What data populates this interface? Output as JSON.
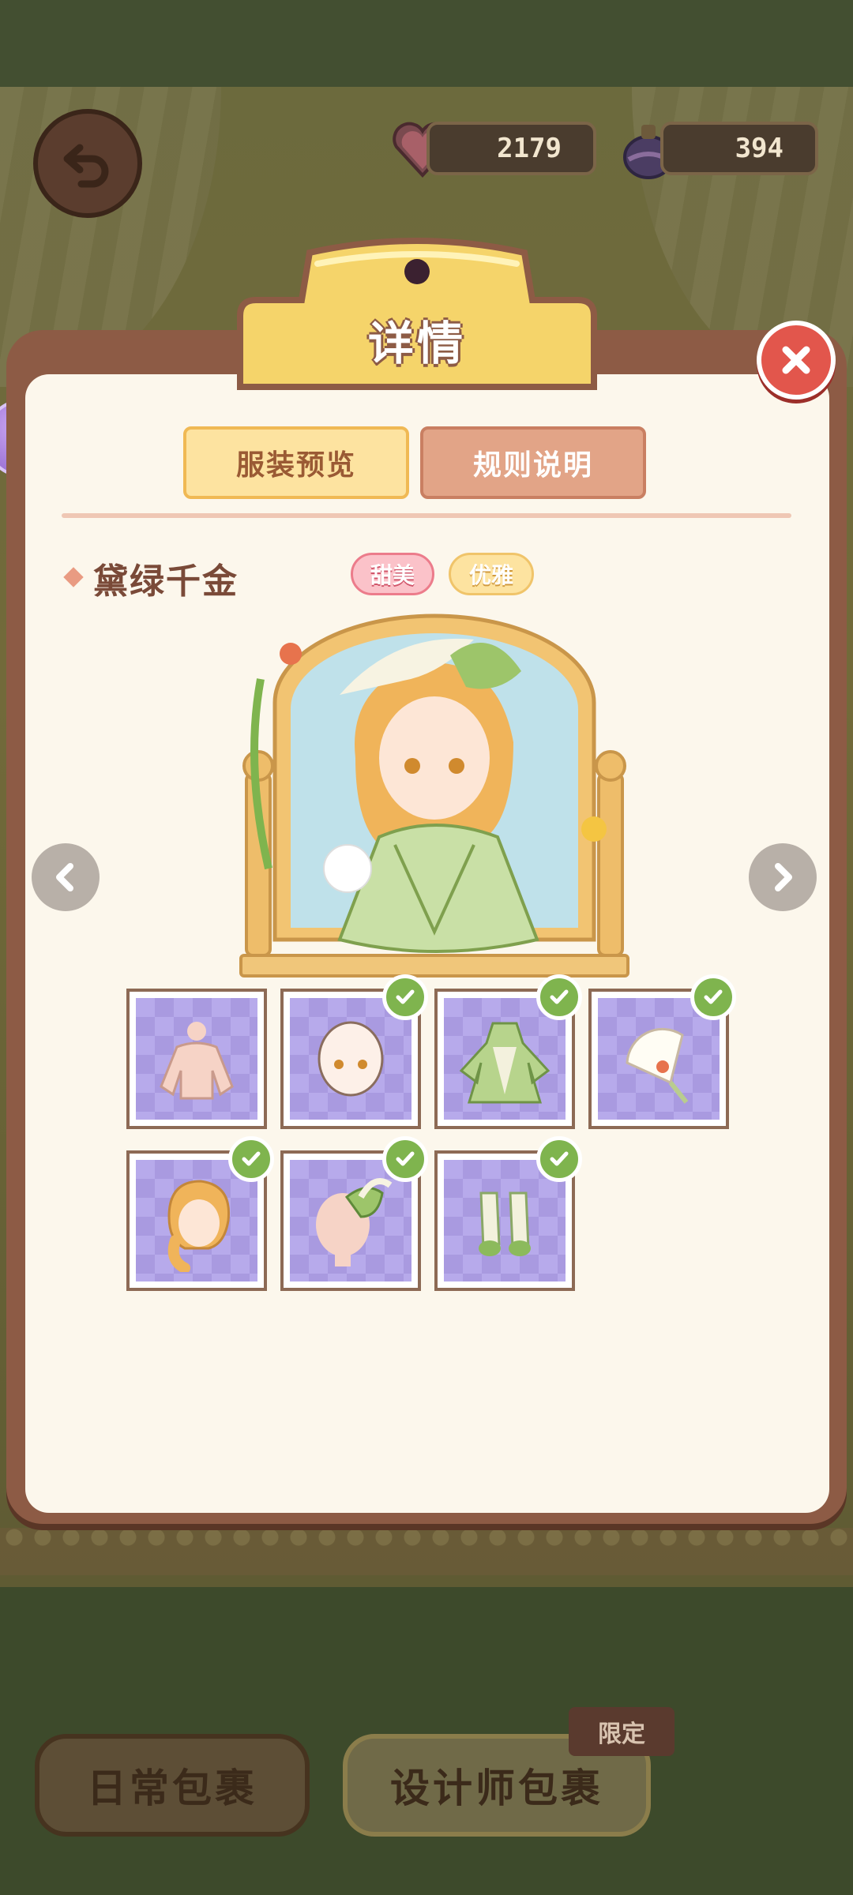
{
  "header": {
    "back_icon": "back-arrow-icon",
    "currencies": [
      {
        "icon": "heart-gem-icon",
        "value": "2179"
      },
      {
        "icon": "potion-icon",
        "value": "394"
      }
    ]
  },
  "modal": {
    "title": "详情",
    "tabs": [
      {
        "label": "服装预览",
        "active": true
      },
      {
        "label": "规则说明",
        "active": false
      }
    ],
    "outfit": {
      "name": "黛绿千金",
      "tags": [
        "甜美",
        "优雅"
      ]
    },
    "items": [
      {
        "name": "base-body",
        "checked": false
      },
      {
        "name": "face",
        "checked": true
      },
      {
        "name": "green-dress",
        "checked": true
      },
      {
        "name": "hand-fan",
        "checked": true
      },
      {
        "name": "braided-hair",
        "checked": true
      },
      {
        "name": "bow-headdress",
        "checked": true
      },
      {
        "name": "green-shoes",
        "checked": true
      }
    ]
  },
  "footer": {
    "daily_label": "日常包裹",
    "designer_label": "设计师包裹",
    "limited_badge": "限定"
  },
  "colors": {
    "modal_frame": "#8d5b45",
    "modal_body": "#fcf7ec",
    "check_green": "#7fb44e",
    "tile_purple": "#b7aaeb"
  }
}
